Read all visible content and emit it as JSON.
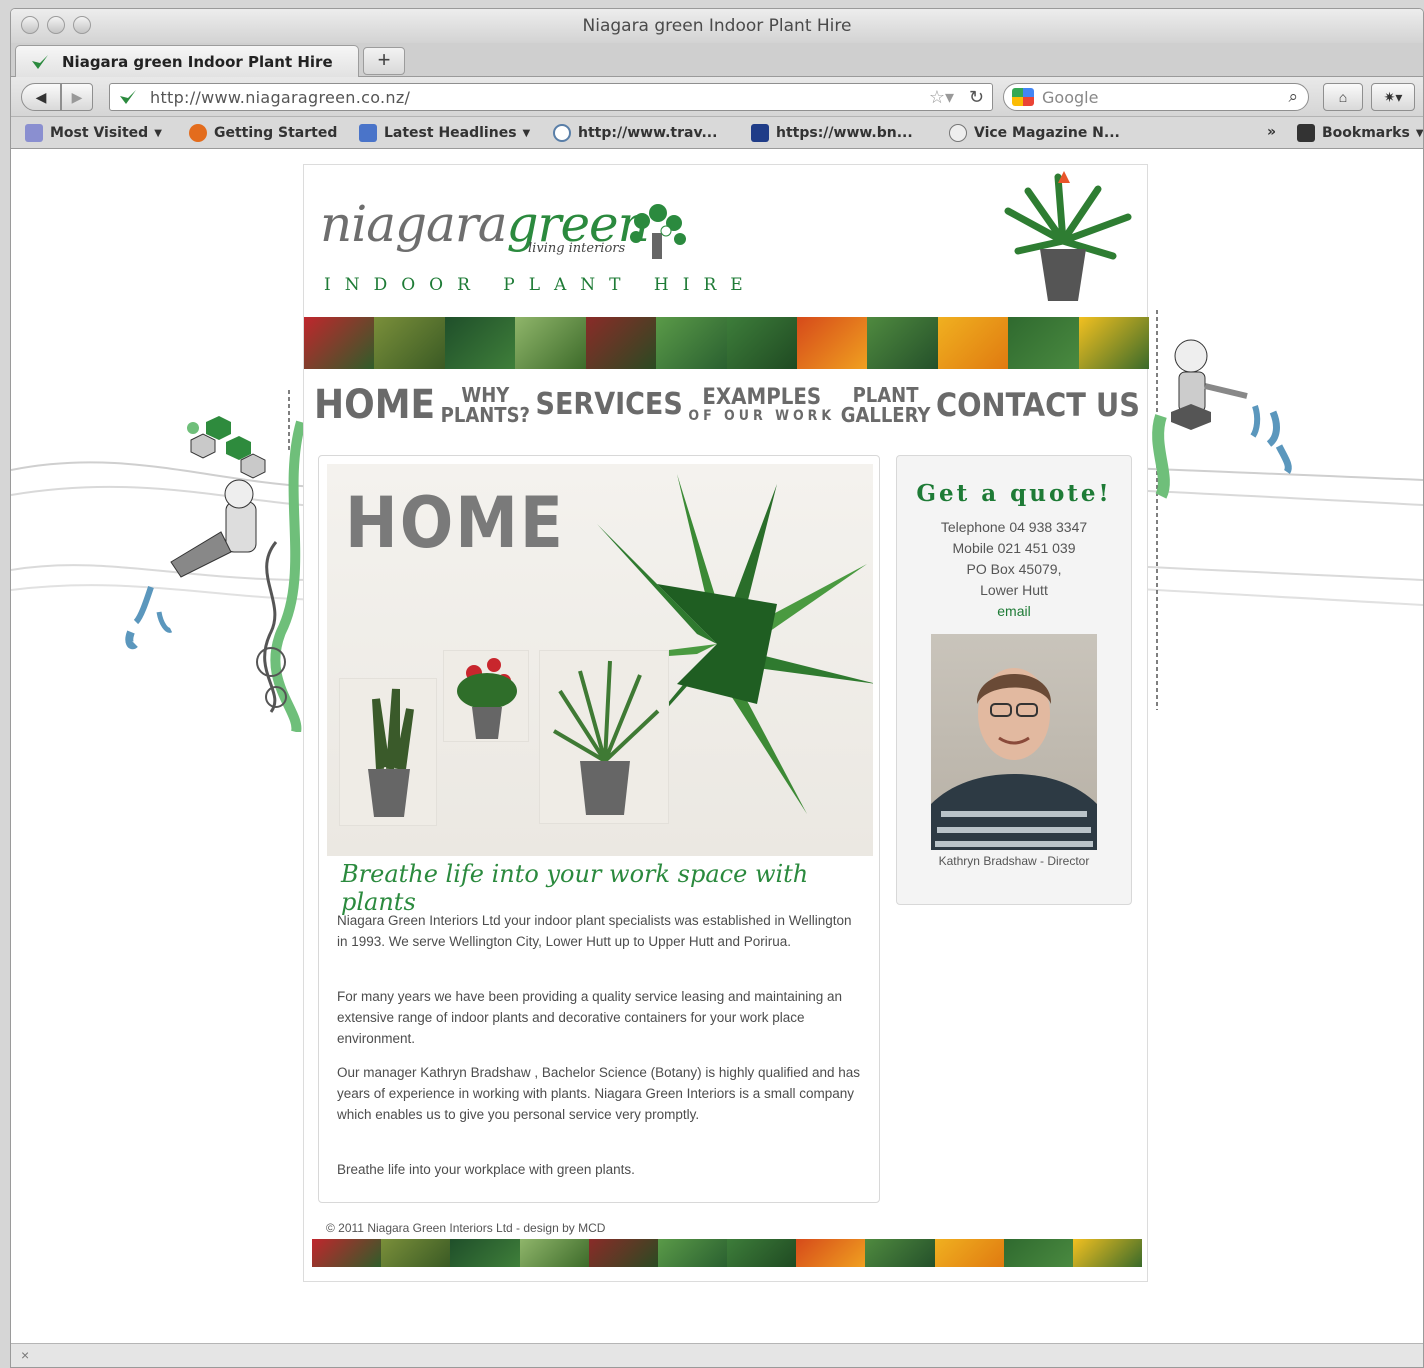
{
  "browser": {
    "window_title": "Niagara green Indoor Plant Hire",
    "tab_label": "Niagara green Indoor Plant Hire",
    "new_tab": "+",
    "url": "http://www.niagaragreen.co.nz/",
    "search_placeholder": "Google",
    "bookmarks": [
      "Most Visited",
      "Getting Started",
      "Latest Headlines",
      "http://www.trav...",
      "https://www.bn...",
      "Vice Magazine N..."
    ],
    "bookmarks_menu": "Bookmarks",
    "overflow": "»",
    "status_close": "×"
  },
  "site": {
    "logo_gray": "niagara",
    "logo_green": "green",
    "logo_sub": "living interiors",
    "tagline": "INDOOR PLANT HIRE",
    "nav": [
      {
        "line1": "Home",
        "line2": ""
      },
      {
        "line1": "Why",
        "line2": "Plants?"
      },
      {
        "line1": "Services",
        "line2": ""
      },
      {
        "line1": "Examples",
        "line2": "of our work"
      },
      {
        "line1": "Plant",
        "line2": "Gallery"
      },
      {
        "line1": "Contact us",
        "line2": ""
      }
    ],
    "home_heading": "HOME",
    "slogan": "Breathe life into your work space with plants",
    "paragraphs": [
      "Niagara Green Interiors Ltd your indoor plant specialists was established in Wellington in 1993. We serve Wellington City, Lower Hutt up to Upper Hutt and Porirua.",
      "For many years we have been providing a quality service leasing and maintaining an extensive range of indoor plants and decorative containers for your work place environment.",
      "Our manager Kathryn Bradshaw , Bachelor Science (Botany) is highly qualified and has years of experience in working with plants. Niagara Green Interiors is a small company which enables us to give you personal service very promptly.",
      "Breathe life into your workplace with green plants."
    ],
    "quote": {
      "title": "Get a quote!",
      "telephone": "Telephone 04 938 3347",
      "mobile": "Mobile 021 451 039",
      "po_box": "PO Box 45079,",
      "city": "Lower Hutt",
      "email": "email",
      "caption": "Kathryn Bradshaw - Director"
    },
    "footer": "© 2011 Niagara Green Interiors Ltd - design by MCD",
    "colors": {
      "brand_green": "#2b8a3e",
      "text_gray": "#4d4d4d"
    }
  }
}
